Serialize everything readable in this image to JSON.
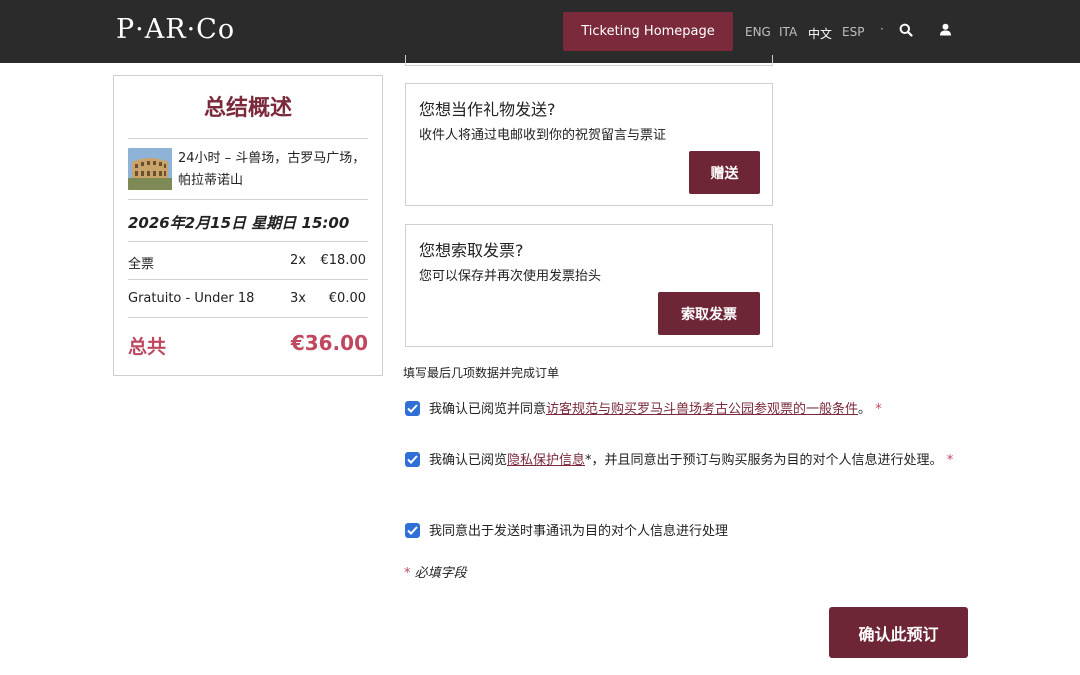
{
  "header": {
    "logo": "P·AR·Co",
    "ticketing_button": "Ticketing Homepage",
    "languages": [
      "ENG",
      "ITA",
      "中文",
      "ESP"
    ],
    "active_language": "中文",
    "separator": "·",
    "icons": [
      "search-icon",
      "user-icon"
    ]
  },
  "summary": {
    "title": "总结概述",
    "tour_name": "24小时 – 斗兽场，古罗马广场，帕拉蒂诺山",
    "thumbnail": "colosseum-image",
    "date": "2026年2月15日 星期日 15:00",
    "tickets": [
      {
        "label": "全票",
        "qty": "2x",
        "price": "€18.00"
      },
      {
        "label": "Gratuito - Under 18",
        "qty": "3x",
        "price": "€0.00"
      }
    ],
    "total_label": "总共",
    "total_value": "€36.00"
  },
  "gift": {
    "title": "您想当作礼物发送?",
    "subtitle": "收件人将通过电邮收到你的祝贺留言与票证",
    "button": "赠送"
  },
  "invoice": {
    "title": "您想索取发票?",
    "subtitle": "您可以保存并再次使用发票抬头",
    "button": "索取发票"
  },
  "complete_note": "填写最后几项数据并完成订单",
  "consents": {
    "terms": {
      "prefix": "我确认已阅览并同意",
      "link": "访客规范与购买罗马斗兽场考古公园参观票的一般条件",
      "suffix": "。",
      "required_mark": "*"
    },
    "privacy": {
      "prefix": "我确认已阅览",
      "link": "隐私保护信息",
      "suffix": "*，并且同意出于预订与购买服务为目的对个人信息进行处理。",
      "required_mark": "*"
    },
    "newsletter": {
      "text": "我同意出于发送时事通讯为目的对个人信息进行处理"
    }
  },
  "required_note": {
    "mark": "*",
    "text": " 必填字段"
  },
  "confirm_button": "确认此预订",
  "colors": {
    "header_bg": "#2b2b2b",
    "brand": "#7a2a3a",
    "button": "#6e2535",
    "accent": "#c0485e",
    "checkbox": "#2f6fd6"
  }
}
